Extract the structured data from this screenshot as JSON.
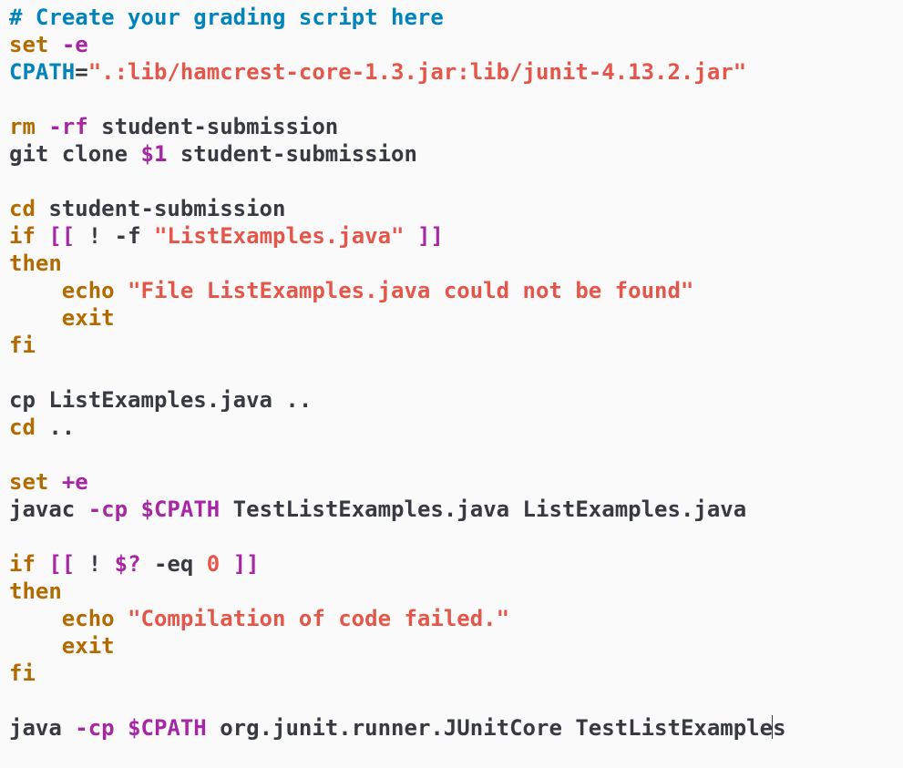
{
  "colors": {
    "background": "#fafafa",
    "default": "#383a42",
    "comment": "#0184bc",
    "keyword": "#b26b00",
    "option": "#a626a4",
    "string": "#e45649",
    "variable": "#a626a4",
    "number": "#e45649",
    "tilde": "#61afef"
  },
  "editor": {
    "lines": [
      [
        {
          "t": "# Create your grading script here",
          "c": "comment"
        }
      ],
      [
        {
          "t": "set",
          "c": "keyword"
        },
        {
          "t": " ",
          "c": "default"
        },
        {
          "t": "-e",
          "c": "option"
        }
      ],
      [
        {
          "t": "CPATH",
          "c": "comment"
        },
        {
          "t": "=",
          "c": "default"
        },
        {
          "t": "\".:lib/hamcrest-core-1.3.jar:lib/junit-4.13.2.jar\"",
          "c": "string"
        }
      ],
      [],
      [
        {
          "t": "rm",
          "c": "keyword"
        },
        {
          "t": " ",
          "c": "default"
        },
        {
          "t": "-rf",
          "c": "option"
        },
        {
          "t": " student-submission",
          "c": "default"
        }
      ],
      [
        {
          "t": "git clone ",
          "c": "default"
        },
        {
          "t": "$1",
          "c": "variable"
        },
        {
          "t": " student-submission",
          "c": "default"
        }
      ],
      [],
      [
        {
          "t": "cd",
          "c": "keyword"
        },
        {
          "t": " student-submission",
          "c": "default"
        }
      ],
      [
        {
          "t": "if",
          "c": "keyword"
        },
        {
          "t": " ",
          "c": "default"
        },
        {
          "t": "[[",
          "c": "option"
        },
        {
          "t": " ! -f ",
          "c": "default"
        },
        {
          "t": "\"ListExamples.java\"",
          "c": "string"
        },
        {
          "t": " ",
          "c": "default"
        },
        {
          "t": "]]",
          "c": "option"
        }
      ],
      [
        {
          "t": "then",
          "c": "keyword"
        }
      ],
      [
        {
          "t": "    ",
          "c": "default"
        },
        {
          "t": "echo",
          "c": "keyword"
        },
        {
          "t": " ",
          "c": "default"
        },
        {
          "t": "\"File ListExamples.java could not be found\"",
          "c": "string"
        }
      ],
      [
        {
          "t": "    ",
          "c": "default"
        },
        {
          "t": "exit",
          "c": "keyword"
        }
      ],
      [
        {
          "t": "fi",
          "c": "keyword"
        }
      ],
      [],
      [
        {
          "t": "cp ListExamples.java ..",
          "c": "default"
        }
      ],
      [
        {
          "t": "cd",
          "c": "keyword"
        },
        {
          "t": " ..",
          "c": "default"
        }
      ],
      [],
      [
        {
          "t": "set",
          "c": "keyword"
        },
        {
          "t": " ",
          "c": "default"
        },
        {
          "t": "+e",
          "c": "option"
        }
      ],
      [
        {
          "t": "javac ",
          "c": "default"
        },
        {
          "t": "-cp",
          "c": "option"
        },
        {
          "t": " ",
          "c": "default"
        },
        {
          "t": "$CPATH",
          "c": "variable"
        },
        {
          "t": " TestListExamples.java ListExamples.java",
          "c": "default"
        }
      ],
      [],
      [
        {
          "t": "if",
          "c": "keyword"
        },
        {
          "t": " ",
          "c": "default"
        },
        {
          "t": "[[",
          "c": "option"
        },
        {
          "t": " ! ",
          "c": "default"
        },
        {
          "t": "$?",
          "c": "variable"
        },
        {
          "t": " -eq ",
          "c": "default"
        },
        {
          "t": "0",
          "c": "number"
        },
        {
          "t": " ",
          "c": "default"
        },
        {
          "t": "]]",
          "c": "option"
        }
      ],
      [
        {
          "t": "then",
          "c": "keyword"
        }
      ],
      [
        {
          "t": "    ",
          "c": "default"
        },
        {
          "t": "echo",
          "c": "keyword"
        },
        {
          "t": " ",
          "c": "default"
        },
        {
          "t": "\"Compilation of code failed.\"",
          "c": "string"
        }
      ],
      [
        {
          "t": "    ",
          "c": "default"
        },
        {
          "t": "exit",
          "c": "keyword"
        }
      ],
      [
        {
          "t": "fi",
          "c": "keyword"
        }
      ],
      [],
      [
        {
          "t": "java ",
          "c": "default"
        },
        {
          "t": "-cp",
          "c": "option"
        },
        {
          "t": " ",
          "c": "default"
        },
        {
          "t": "$CPATH",
          "c": "variable"
        },
        {
          "t": " org.junit.runner.JUnitCore TestListExample",
          "c": "default"
        },
        {
          "cursor": true
        },
        {
          "t": "s",
          "c": "default"
        }
      ]
    ],
    "end_marker": "~"
  }
}
